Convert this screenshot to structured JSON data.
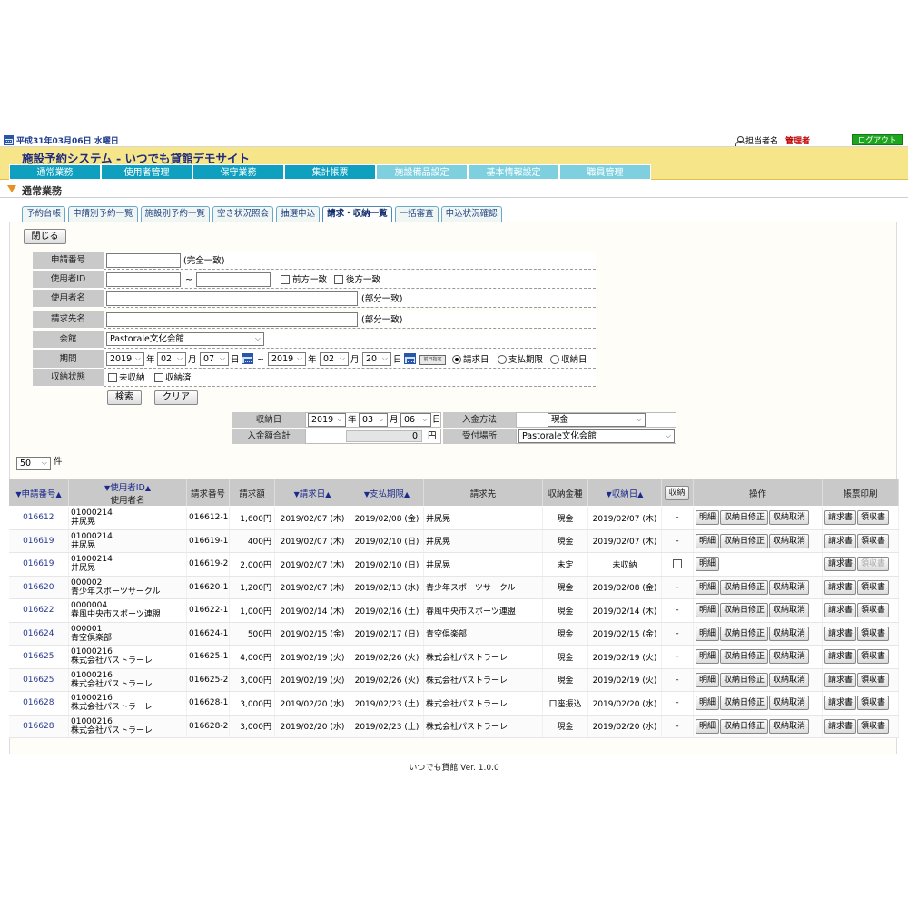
{
  "topbar": {
    "date": "平成31年03月06日 水曜日",
    "staff_label": "担当者名",
    "staff_name": "管理者",
    "logout": "ログアウト"
  },
  "app": {
    "title": "施設予約システム - いつでも貸館デモサイト"
  },
  "main_nav": [
    "通常業務",
    "使用者管理",
    "保守業務",
    "集計帳票",
    "施設備品設定",
    "基本情報設定",
    "職員管理"
  ],
  "section": {
    "title": "通常業務"
  },
  "sub_tabs": [
    "予約台帳",
    "申請別予約一覧",
    "施設別予約一覧",
    "空き状況照会",
    "抽選申込",
    "請求・収納一覧",
    "一括審査",
    "申込状況確認"
  ],
  "close_button": "閉じる",
  "search": {
    "labels": [
      "申請番号",
      "使用者ID",
      "使用者名",
      "請求先名",
      "会館",
      "期間",
      "収納状態"
    ],
    "app_no_note": "(完全一致)",
    "range_sep": "~",
    "forward_match": "前方一致",
    "backward_match": "後方一致",
    "partial_match": "(部分一致)",
    "hall": "Pastorale文化会館",
    "period": {
      "from_year": "2019",
      "from_month": "02",
      "from_day": "07",
      "to_year": "2019",
      "to_month": "02",
      "to_day": "20",
      "year_unit": "年",
      "month_unit": "月",
      "day_unit": "日",
      "sep": "~",
      "today_btn": "前日指定",
      "radio_invoice": "請求日",
      "radio_due": "支払期限",
      "radio_receipt": "収納日"
    },
    "unreceived": "未収納",
    "received": "収納済",
    "search_btn": "検索",
    "clear_btn": "クリア"
  },
  "receipt_panel": {
    "date_label": "収納日",
    "year": "2019",
    "month": "03",
    "day": "06",
    "year_unit": "年",
    "month_unit": "月",
    "day_unit": "日",
    "method_label": "入金方法",
    "method": "現金",
    "total_label": "入金額合計",
    "total": "0",
    "yen": "円",
    "place_label": "受付場所",
    "place": "Pastorale文化会館"
  },
  "per_page": {
    "value": "50",
    "unit": "件"
  },
  "table": {
    "headers": {
      "app_no": "申請番号",
      "user_id": "使用者ID",
      "user_name": "使用者名",
      "invoice_no": "請求番号",
      "amount": "請求額",
      "invoice_date": "請求日",
      "due_date": "支払期限",
      "payer": "請求先",
      "method": "収納金種",
      "receipt_date": "収納日",
      "receipt_btn": "収納",
      "ops": "操作",
      "print": "帳票印刷"
    },
    "rows": [
      {
        "app_no": "016612",
        "user_id": "01000214",
        "user_name": "井尻晃",
        "invoice_no": "016612-1",
        "amount": "1,600円",
        "invoice_date": "2019/02/07 (木)",
        "due_date": "2019/02/08 (金)",
        "payer": "井尻晃",
        "method": "現金",
        "receipt_date": "2019/02/07 (木)",
        "mark": "-",
        "ops": [
          "明細",
          "収納日修正",
          "収納取消"
        ],
        "print": [
          "請求書",
          "領収書"
        ],
        "receipt_disabled": false
      },
      {
        "app_no": "016619",
        "user_id": "01000214",
        "user_name": "井尻晃",
        "invoice_no": "016619-1",
        "amount": "400円",
        "invoice_date": "2019/02/07 (木)",
        "due_date": "2019/02/10 (日)",
        "payer": "井尻晃",
        "method": "現金",
        "receipt_date": "2019/02/07 (木)",
        "mark": "-",
        "ops": [
          "明細",
          "収納日修正",
          "収納取消"
        ],
        "print": [
          "請求書",
          "領収書"
        ],
        "receipt_disabled": false
      },
      {
        "app_no": "016619",
        "user_id": "01000214",
        "user_name": "井尻晃",
        "invoice_no": "016619-2",
        "amount": "2,000円",
        "invoice_date": "2019/02/07 (木)",
        "due_date": "2019/02/10 (日)",
        "payer": "井尻晃",
        "method": "未定",
        "receipt_date": "未収納",
        "mark": "checkbox",
        "ops": [
          "明細"
        ],
        "print": [
          "請求書",
          "領収書"
        ],
        "receipt_disabled": true
      },
      {
        "app_no": "016620",
        "user_id": "000002",
        "user_name": "青少年スポーツサークル",
        "invoice_no": "016620-1",
        "amount": "1,200円",
        "invoice_date": "2019/02/07 (木)",
        "due_date": "2019/02/13 (水)",
        "payer": "青少年スポーツサークル",
        "method": "現金",
        "receipt_date": "2019/02/08 (金)",
        "mark": "-",
        "ops": [
          "明細",
          "収納日修正",
          "収納取消"
        ],
        "print": [
          "請求書",
          "領収書"
        ],
        "receipt_disabled": false
      },
      {
        "app_no": "016622",
        "user_id": "0000004",
        "user_name": "春風中央市スポーツ連盟",
        "invoice_no": "016622-1",
        "amount": "1,000円",
        "invoice_date": "2019/02/14 (木)",
        "due_date": "2019/02/16 (土)",
        "payer": "春風中央市スポーツ連盟",
        "method": "現金",
        "receipt_date": "2019/02/14 (木)",
        "mark": "-",
        "ops": [
          "明細",
          "収納日修正",
          "収納取消"
        ],
        "print": [
          "請求書",
          "領収書"
        ],
        "receipt_disabled": false
      },
      {
        "app_no": "016624",
        "user_id": "000001",
        "user_name": "青空倶楽部",
        "invoice_no": "016624-1",
        "amount": "500円",
        "invoice_date": "2019/02/15 (金)",
        "due_date": "2019/02/17 (日)",
        "payer": "青空倶楽部",
        "method": "現金",
        "receipt_date": "2019/02/15 (金)",
        "mark": "-",
        "ops": [
          "明細",
          "収納日修正",
          "収納取消"
        ],
        "print": [
          "請求書",
          "領収書"
        ],
        "receipt_disabled": false
      },
      {
        "app_no": "016625",
        "user_id": "01000216",
        "user_name": "株式会社パストラーレ",
        "invoice_no": "016625-1",
        "amount": "4,000円",
        "invoice_date": "2019/02/19 (火)",
        "due_date": "2019/02/26 (火)",
        "payer": "株式会社パストラーレ",
        "method": "現金",
        "receipt_date": "2019/02/19 (火)",
        "mark": "-",
        "ops": [
          "明細",
          "収納日修正",
          "収納取消"
        ],
        "print": [
          "請求書",
          "領収書"
        ],
        "receipt_disabled": false
      },
      {
        "app_no": "016625",
        "user_id": "01000216",
        "user_name": "株式会社パストラーレ",
        "invoice_no": "016625-2",
        "amount": "3,000円",
        "invoice_date": "2019/02/19 (火)",
        "due_date": "2019/02/26 (火)",
        "payer": "株式会社パストラーレ",
        "method": "現金",
        "receipt_date": "2019/02/19 (火)",
        "mark": "-",
        "ops": [
          "明細",
          "収納日修正",
          "収納取消"
        ],
        "print": [
          "請求書",
          "領収書"
        ],
        "receipt_disabled": false
      },
      {
        "app_no": "016628",
        "user_id": "01000216",
        "user_name": "株式会社パストラーレ",
        "invoice_no": "016628-1",
        "amount": "3,000円",
        "invoice_date": "2019/02/20 (水)",
        "due_date": "2019/02/23 (土)",
        "payer": "株式会社パストラーレ",
        "method": "口座振込",
        "receipt_date": "2019/02/20 (水)",
        "mark": "-",
        "ops": [
          "明細",
          "収納日修正",
          "収納取消"
        ],
        "print": [
          "請求書",
          "領収書"
        ],
        "receipt_disabled": false
      },
      {
        "app_no": "016628",
        "user_id": "01000216",
        "user_name": "株式会社パストラーレ",
        "invoice_no": "016628-2",
        "amount": "3,000円",
        "invoice_date": "2019/02/20 (水)",
        "due_date": "2019/02/23 (土)",
        "payer": "株式会社パストラーレ",
        "method": "現金",
        "receipt_date": "2019/02/20 (水)",
        "mark": "-",
        "ops": [
          "明細",
          "収納日修正",
          "収納取消"
        ],
        "print": [
          "請求書",
          "領収書"
        ],
        "receipt_disabled": false
      }
    ]
  },
  "footer": {
    "text": "いつでも貸館 Ver. 1.0.0"
  },
  "colors": {
    "nav": "#0fa0bf",
    "header": "#f7e58a",
    "logout": "#1ea51e",
    "admin": "#c00000"
  }
}
